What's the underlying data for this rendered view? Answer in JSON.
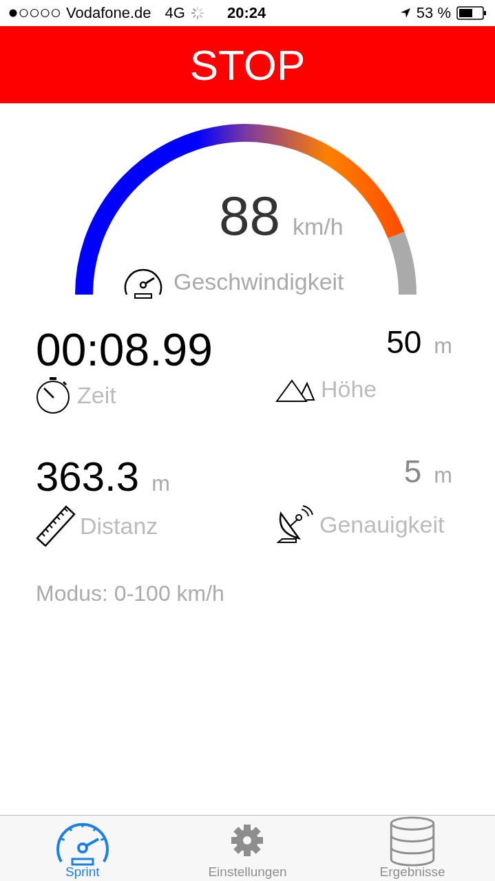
{
  "status_bar": {
    "carrier": "Vodafone.de",
    "network": "4G",
    "time": "20:24",
    "battery": "53 %"
  },
  "stop_button": {
    "label": "STOP"
  },
  "speedometer": {
    "value": "88",
    "unit": "km/h",
    "label": "Geschwindigkeit"
  },
  "metrics": [
    {
      "kind": "stopwatch",
      "value": "00:08.99",
      "label": "Zeit",
      "dimmed": false
    },
    {
      "kind": "mountains",
      "value": "50",
      "unit": "m",
      "label": "Höhe",
      "dimmed": false
    },
    {
      "kind": "ruler",
      "value": "363.3",
      "unit": "m",
      "label": "Distanz",
      "dimmed": false
    },
    {
      "kind": "dish",
      "value": "5",
      "unit": "m",
      "label": "Genauigkeit",
      "dimmed": true
    }
  ],
  "mode": "Modus: 0-100 km/h",
  "tabs": [
    {
      "kind": "gauge",
      "label": "Sprint",
      "selected": true
    },
    {
      "kind": "gear",
      "label": "Einstellungen",
      "selected": false
    },
    {
      "kind": "database",
      "label": "Ergebnisse",
      "selected": false
    }
  ]
}
